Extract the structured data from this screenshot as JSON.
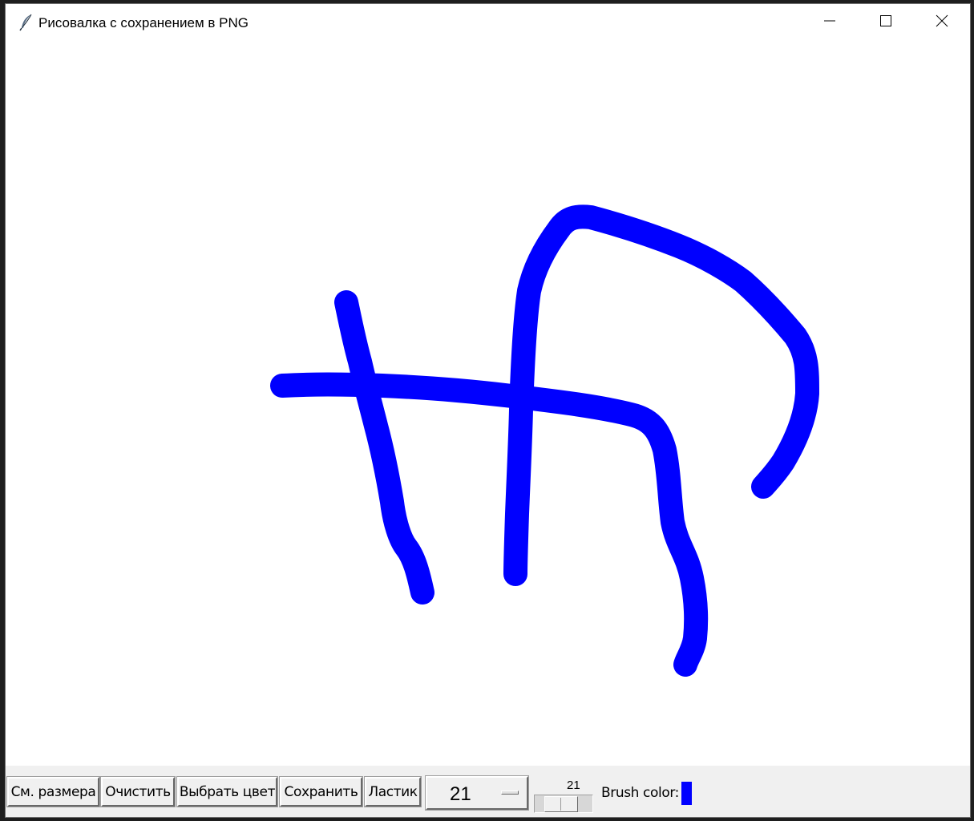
{
  "window": {
    "title": "Рисовалка с сохранением в PNG",
    "icon": "feather-icon",
    "controls": {
      "minimize_icon": "minimize-icon",
      "maximize_icon": "maximize-icon",
      "close_icon": "close-icon"
    }
  },
  "canvas": {
    "background": "#ffffff",
    "stroke_color": "#0000ff",
    "stroke_width": 21
  },
  "toolbar": {
    "buttons": {
      "resize": "См. размера",
      "clear": "Очистить",
      "choose_color": "Выбрать цвет",
      "save": "Сохранить",
      "eraser": "Ластик"
    },
    "size_menu": {
      "value": "21"
    },
    "size_scale": {
      "value": "21",
      "min": 1,
      "max": 50
    },
    "brush_color_label": "Brush color:",
    "brush_color": "#0000ff"
  }
}
